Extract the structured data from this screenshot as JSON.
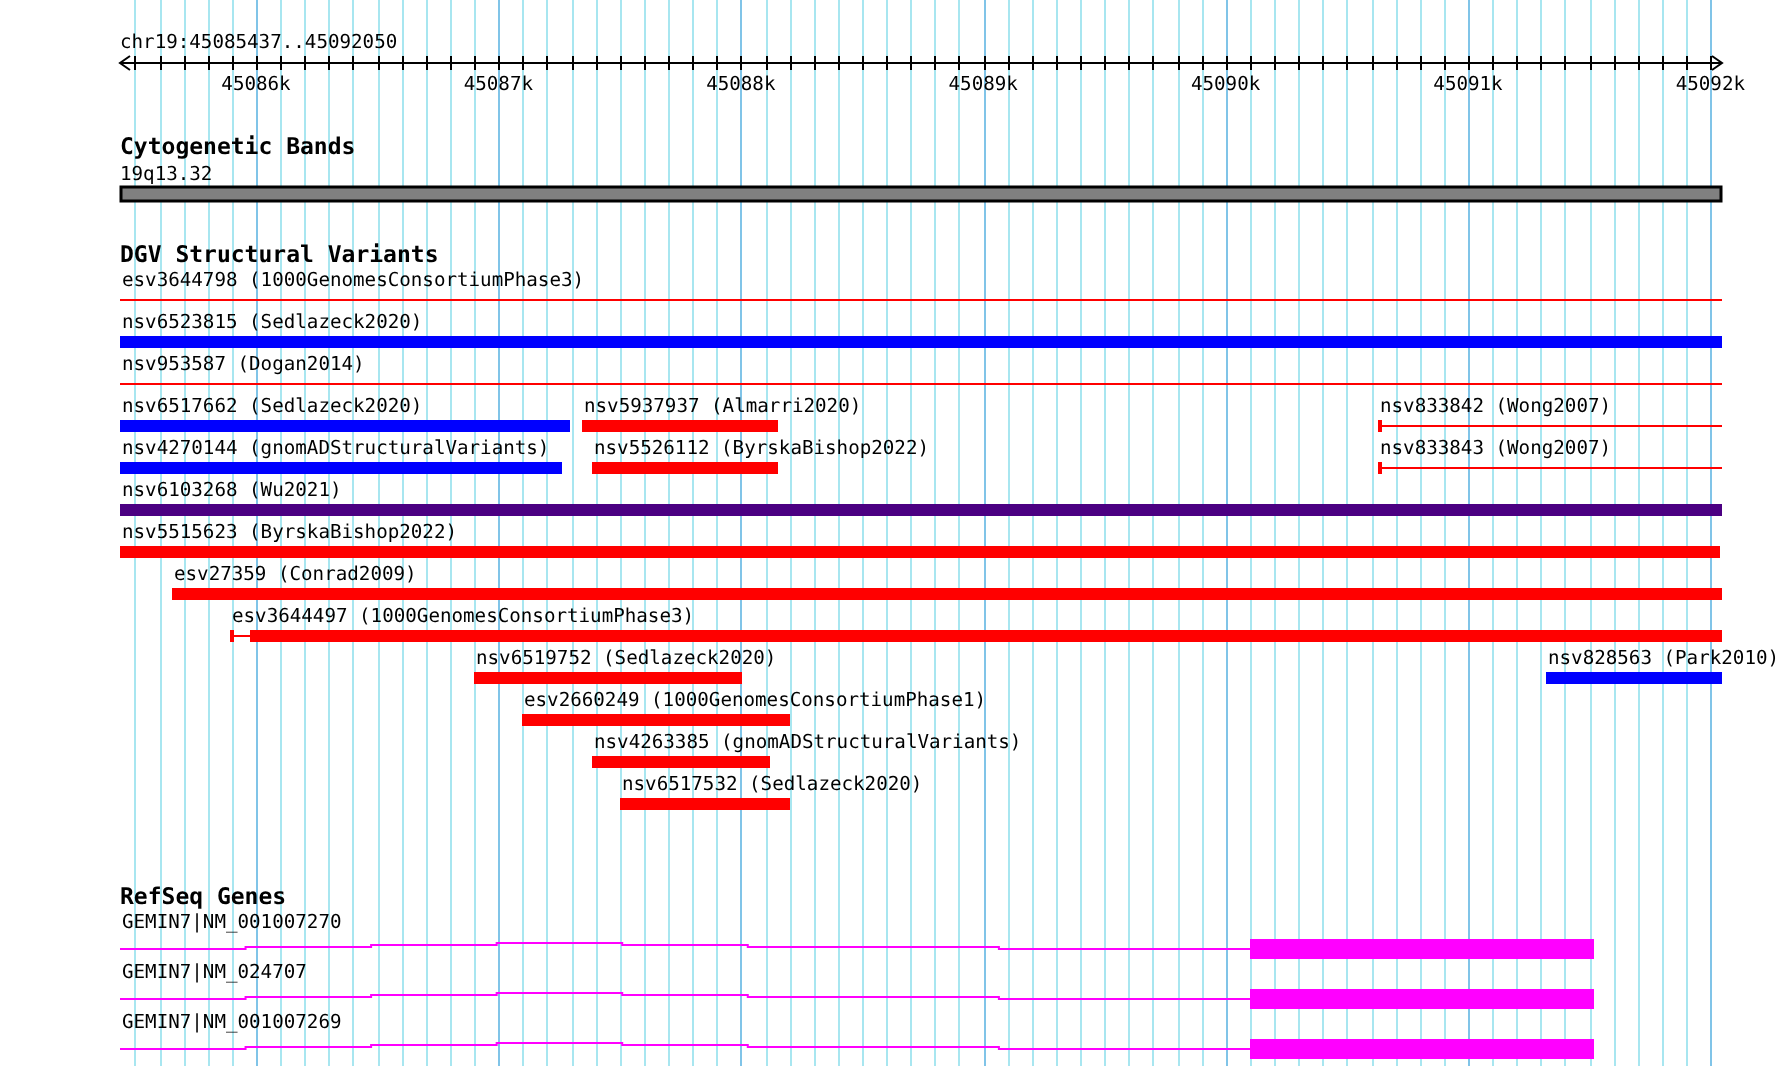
{
  "ruler": {
    "location": "chr19:45085437..45092050",
    "ticks": [
      {
        "label": "45086k"
      },
      {
        "label": "45087k"
      },
      {
        "label": "45088k"
      },
      {
        "label": "45089k"
      },
      {
        "label": "45090k"
      },
      {
        "label": "45091k"
      },
      {
        "label": "45092k"
      }
    ]
  },
  "tracks": [
    {
      "kind": "cytobands",
      "title": "Cytogenetic Bands",
      "bands": [
        {
          "label": "19q13.32"
        }
      ]
    },
    {
      "kind": "variants",
      "title": "DGV Structural Variants",
      "rows": [
        {
          "features": [
            {
              "label": "esv3644798 (1000GenomesConsortiumPhase3)",
              "kind": "line",
              "color": "#ff0000"
            }
          ]
        },
        {
          "features": [
            {
              "label": "nsv6523815 (Sedlazeck2020)",
              "kind": "bar",
              "color": "#0000ff"
            }
          ]
        },
        {
          "features": [
            {
              "label": "nsv953587 (Dogan2014)",
              "kind": "line",
              "color": "#ff0000"
            }
          ]
        },
        {
          "features": [
            {
              "label": "nsv6517662 (Sedlazeck2020)",
              "kind": "bar",
              "color": "#0000ff"
            },
            {
              "label": "nsv5937937 (Almarri2020)",
              "kind": "bar",
              "color": "#ff0000"
            },
            {
              "label": "nsv833842 (Wong2007)",
              "kind": "line",
              "color": "#ff0000"
            }
          ]
        },
        {
          "features": [
            {
              "label": "nsv4270144 (gnomADStructuralVariants)",
              "kind": "bar",
              "color": "#0000ff"
            },
            {
              "label": "nsv5526112 (ByrskaBishop2022)",
              "kind": "bar",
              "color": "#ff0000"
            },
            {
              "label": "nsv833843 (Wong2007)",
              "kind": "line",
              "color": "#ff0000"
            }
          ]
        },
        {
          "features": [
            {
              "label": "nsv6103268 (Wu2021)",
              "kind": "bar",
              "color": "#4b0082"
            }
          ]
        },
        {
          "features": [
            {
              "label": "nsv5515623 (ByrskaBishop2022)",
              "kind": "bar",
              "color": "#ff0000"
            }
          ]
        },
        {
          "features": [
            {
              "label": "esv27359 (Conrad2009)",
              "kind": "bar",
              "color": "#ff0000"
            }
          ]
        },
        {
          "features": [
            {
              "label": "esv3644497 (1000GenomesConsortiumPhase3)",
              "kind": "split",
              "color": "#ff0000"
            }
          ]
        },
        {
          "features": [
            {
              "label": "nsv6519752 (Sedlazeck2020)",
              "kind": "bar",
              "color": "#ff0000"
            },
            {
              "label": "nsv828563 (Park2010)",
              "kind": "bar",
              "color": "#0000ff"
            }
          ]
        },
        {
          "features": [
            {
              "label": "esv2660249 (1000GenomesConsortiumPhase1)",
              "kind": "bar",
              "color": "#ff0000"
            }
          ]
        },
        {
          "features": [
            {
              "label": "nsv4263385 (gnomADStructuralVariants)",
              "kind": "bar",
              "color": "#ff0000"
            }
          ]
        },
        {
          "features": [
            {
              "label": "nsv6517532 (Sedlazeck2020)",
              "kind": "bar",
              "color": "#ff0000"
            }
          ]
        }
      ]
    },
    {
      "kind": "genes",
      "title": "RefSeq Genes",
      "genes": [
        {
          "label": "GEMIN7|NM_001007270"
        },
        {
          "label": "GEMIN7|NM_024707"
        },
        {
          "label": "GEMIN7|NM_001007269"
        }
      ]
    }
  ]
}
